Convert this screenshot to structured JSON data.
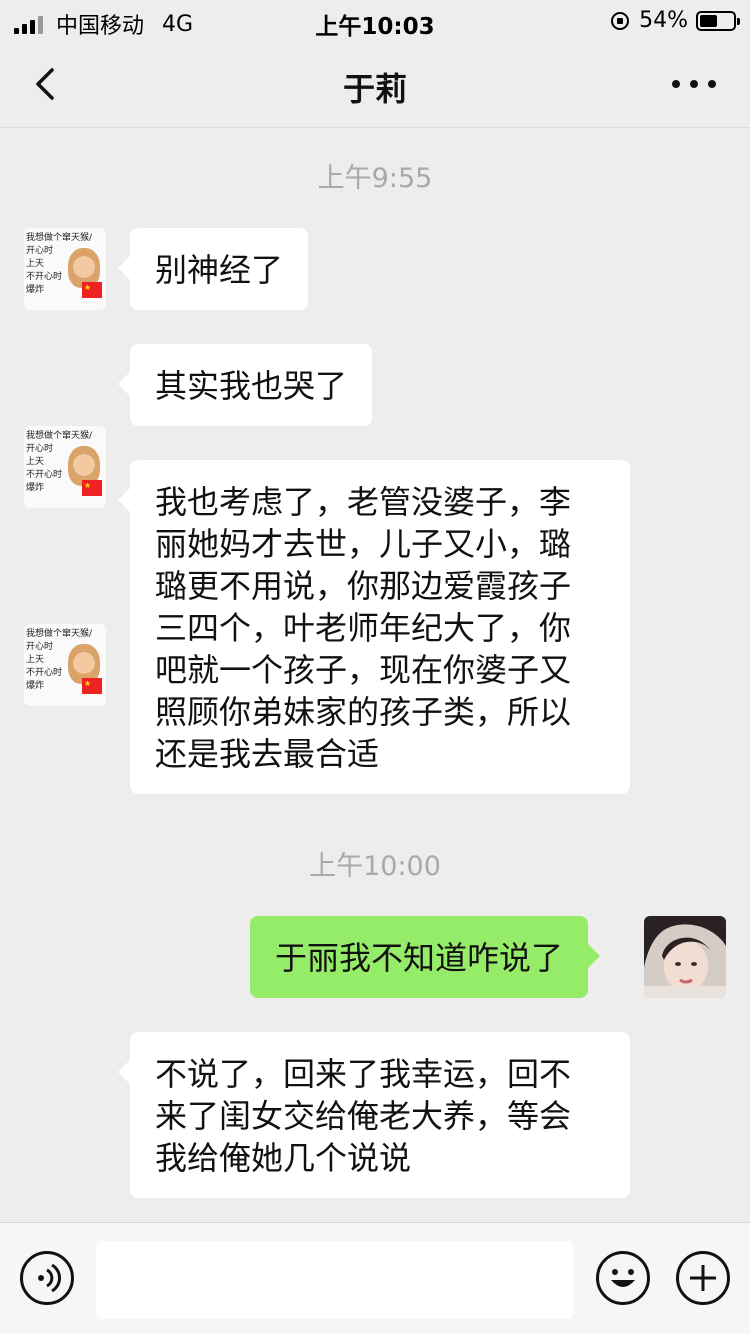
{
  "status_bar": {
    "carrier": "中国移动",
    "network": "4G",
    "time": "上午10:03",
    "battery": "54%",
    "battery_level": 0.54
  },
  "nav": {
    "title": "于莉"
  },
  "messages": {
    "ts1": "上午9:55",
    "m1": "别神经了",
    "m2": "其实我也哭了",
    "m3_lines": [
      "我也考虑了，老管没婆子，李",
      "丽她妈才去世，儿子又小，璐",
      "璐更不用说，你那边爱霞孩子",
      "三四个，叶老师年纪大了，你",
      "吧就一个孩子，现在你婆子又",
      "照顾你弟妹家的孩子类，所以",
      "还是我去最合适"
    ],
    "ts2": "上午10:00",
    "m4": "于丽我不知道咋说了",
    "m5_lines": [
      "不说了，回来了我幸运，回不",
      "来了闺女交给俺老大养，等会",
      "我给俺她几个说说"
    ]
  },
  "sticker": {
    "lines": [
      "我想做个窜天猴/",
      "开心时",
      "上天",
      "不开心时",
      "爆炸"
    ]
  },
  "input": {
    "value": ""
  }
}
